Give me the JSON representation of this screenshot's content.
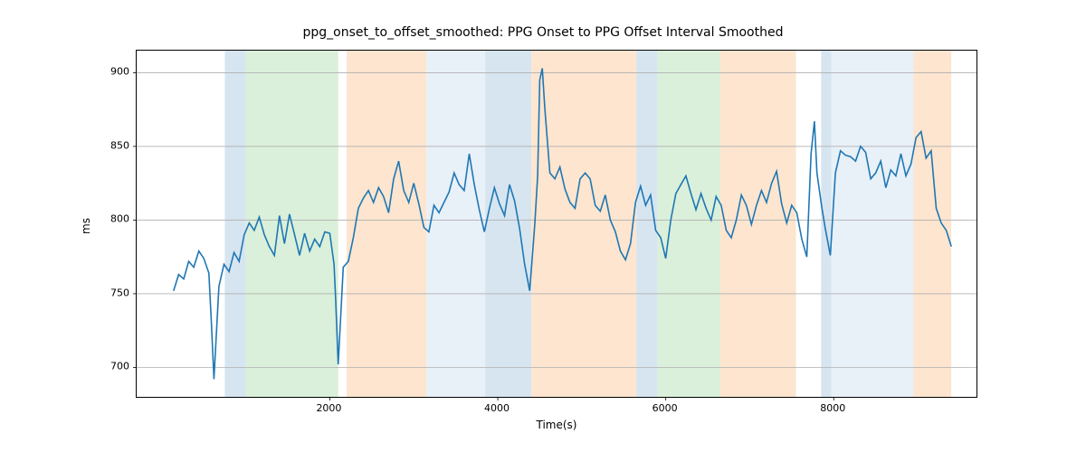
{
  "chart_data": {
    "type": "line",
    "title": "ppg_onset_to_offset_smoothed: PPG Onset to PPG Offset Interval Smoothed",
    "xlabel": "Time(s)",
    "ylabel": "ms",
    "xlim": [
      -300,
      9700
    ],
    "ylim": [
      680,
      915
    ],
    "xticks": [
      2000,
      4000,
      6000,
      8000
    ],
    "yticks": [
      700,
      750,
      800,
      850,
      900
    ],
    "regions": [
      {
        "start": 750,
        "end": 1000,
        "color": "#d6e5f0"
      },
      {
        "start": 1000,
        "end": 2100,
        "color": "#daf0da"
      },
      {
        "start": 2200,
        "end": 3150,
        "color": "#fde5cf"
      },
      {
        "start": 3150,
        "end": 3850,
        "color": "#e8f0f8"
      },
      {
        "start": 3850,
        "end": 4400,
        "color": "#d6e5f0"
      },
      {
        "start": 4400,
        "end": 5650,
        "color": "#fde5cf"
      },
      {
        "start": 5650,
        "end": 5900,
        "color": "#d6e5f0"
      },
      {
        "start": 5900,
        "end": 6650,
        "color": "#daf0da"
      },
      {
        "start": 6650,
        "end": 7550,
        "color": "#fde5cf"
      },
      {
        "start": 7850,
        "end": 7970,
        "color": "#d6e5f0"
      },
      {
        "start": 7970,
        "end": 8950,
        "color": "#e8f0f8"
      },
      {
        "start": 8950,
        "end": 9400,
        "color": "#fde5cf"
      }
    ],
    "series": [
      {
        "name": "ppg_onset_to_offset_smoothed",
        "x": [
          140,
          200,
          260,
          320,
          380,
          440,
          500,
          560,
          590,
          620,
          680,
          740,
          800,
          860,
          920,
          980,
          1040,
          1100,
          1160,
          1220,
          1280,
          1340,
          1400,
          1460,
          1520,
          1580,
          1640,
          1700,
          1760,
          1820,
          1880,
          1940,
          2000,
          2050,
          2070,
          2100,
          2160,
          2220,
          2280,
          2340,
          2400,
          2460,
          2520,
          2580,
          2640,
          2700,
          2760,
          2820,
          2880,
          2940,
          3000,
          3060,
          3120,
          3180,
          3240,
          3300,
          3360,
          3420,
          3480,
          3540,
          3600,
          3660,
          3720,
          3780,
          3840,
          3900,
          3960,
          4020,
          4080,
          4140,
          4200,
          4260,
          4320,
          4380,
          4440,
          4475,
          4500,
          4530,
          4560,
          4620,
          4680,
          4740,
          4800,
          4860,
          4920,
          4980,
          5040,
          5100,
          5160,
          5220,
          5280,
          5340,
          5400,
          5460,
          5520,
          5580,
          5640,
          5700,
          5760,
          5820,
          5880,
          5940,
          6000,
          6060,
          6120,
          6180,
          6240,
          6300,
          6360,
          6420,
          6480,
          6540,
          6600,
          6660,
          6720,
          6780,
          6840,
          6900,
          6960,
          7020,
          7080,
          7140,
          7200,
          7260,
          7320,
          7380,
          7440,
          7500,
          7560,
          7620,
          7680,
          7730,
          7770,
          7800,
          7860,
          7900,
          7960,
          8020,
          8080,
          8140,
          8200,
          8260,
          8320,
          8380,
          8440,
          8500,
          8560,
          8620,
          8680,
          8740,
          8800,
          8860,
          8920,
          8980,
          9040,
          9100,
          9160,
          9220,
          9280,
          9340,
          9400
        ],
        "y": [
          752,
          763,
          760,
          772,
          768,
          779,
          774,
          764,
          730,
          692,
          755,
          770,
          765,
          778,
          772,
          790,
          798,
          793,
          802,
          790,
          782,
          776,
          803,
          784,
          804,
          790,
          776,
          791,
          779,
          787,
          782,
          792,
          791,
          770,
          746,
          702,
          768,
          772,
          788,
          808,
          815,
          820,
          812,
          822,
          816,
          805,
          828,
          840,
          820,
          812,
          825,
          811,
          795,
          792,
          810,
          805,
          812,
          819,
          832,
          824,
          820,
          845,
          824,
          807,
          792,
          808,
          822,
          811,
          803,
          824,
          813,
          794,
          770,
          752,
          797,
          830,
          895,
          903,
          876,
          832,
          828,
          836,
          821,
          812,
          808,
          828,
          832,
          828,
          810,
          806,
          817,
          800,
          792,
          779,
          773,
          784,
          812,
          823,
          810,
          817,
          793,
          788,
          774,
          800,
          818,
          824,
          830,
          818,
          807,
          818,
          808,
          800,
          816,
          810,
          793,
          788,
          800,
          817,
          810,
          797,
          810,
          820,
          812,
          825,
          833,
          811,
          798,
          810,
          805,
          787,
          775,
          845,
          867,
          832,
          808,
          794,
          776,
          832,
          847,
          844,
          843,
          840,
          850,
          846,
          828,
          832,
          840,
          822,
          834,
          830,
          845,
          830,
          838,
          856,
          860,
          842,
          847,
          808,
          798,
          793,
          782
        ]
      }
    ]
  }
}
